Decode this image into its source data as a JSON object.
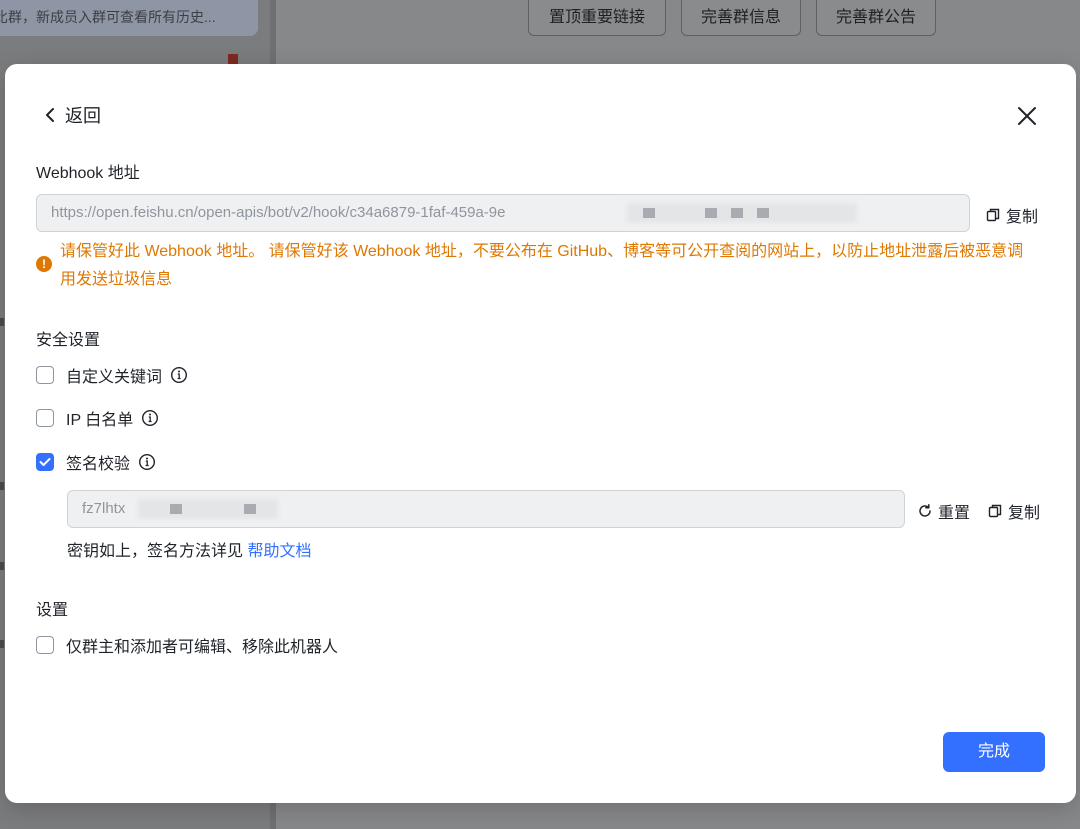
{
  "background": {
    "left_preview_text": "比群，新成员入群可查看所有历史...",
    "top_buttons": [
      "置顶重要链接",
      "完善群信息",
      "完善群公告"
    ]
  },
  "modal": {
    "back_label": "返回",
    "webhook": {
      "label": "Webhook 地址",
      "url_value": "https://open.feishu.cn/open-apis/bot/v2/hook/c34a6879-1faf-459a-9e",
      "copy_label": "复制",
      "warning": "请保管好此 Webhook 地址。 请保管好该 Webhook 地址，不要公布在 GitHub、博客等可公开查阅的网站上，以防止地址泄露后被恶意调用发送垃圾信息"
    },
    "security": {
      "label": "安全设置",
      "options": [
        {
          "label": "自定义关键词",
          "checked": false
        },
        {
          "label": "IP 白名单",
          "checked": false
        },
        {
          "label": "签名校验",
          "checked": true
        }
      ],
      "secret_value": "fz7lhtx",
      "reset_label": "重置",
      "copy_label": "复制",
      "hint_text": "密钥如上，签名方法详见 ",
      "help_link": "帮助文档"
    },
    "settings": {
      "label": "设置",
      "option_label": "仅群主和添加者可编辑、移除此机器人",
      "option_checked": false
    },
    "done_label": "完成"
  },
  "colors": {
    "accent": "#3370ff",
    "warning": "#de7802"
  }
}
